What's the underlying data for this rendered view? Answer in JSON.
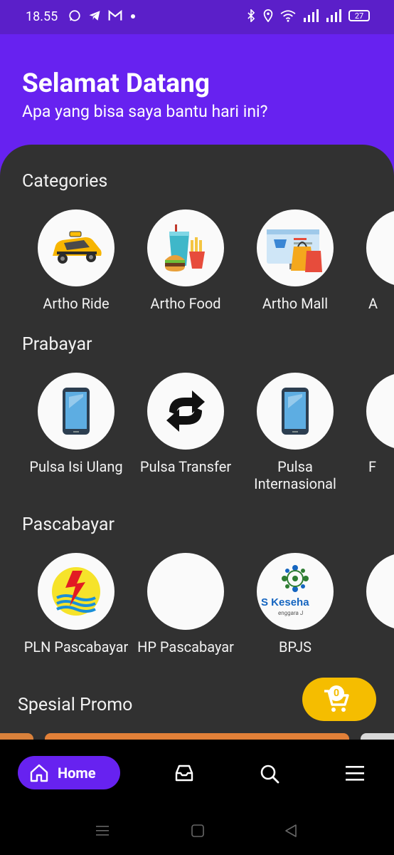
{
  "status_bar": {
    "time": "18.55",
    "battery": "27"
  },
  "header": {
    "title": "Selamat Datang",
    "subtitle": "Apa yang bisa saya bantu hari ini?"
  },
  "sections": {
    "categories": {
      "title": "Categories",
      "items": [
        "Artho Ride",
        "Artho Food",
        "Artho Mall"
      ],
      "partial_label": "A"
    },
    "prabayar": {
      "title": "Prabayar",
      "items": [
        "Pulsa Isi Ulang",
        "Pulsa Transfer",
        "Pulsa Internasional"
      ],
      "partial_label": "F"
    },
    "pascabayar": {
      "title": "Pascabayar",
      "items": [
        "PLN Pascabayar",
        "HP Pascabayar",
        "BPJS"
      ]
    }
  },
  "bpjs_logo_text": "S Keseha",
  "bpjs_logo_subtext": "enggara J",
  "promo": {
    "title": "Spesial Promo"
  },
  "cart": {
    "count": "0"
  },
  "bottom_nav": {
    "home_label": "Home"
  },
  "colors": {
    "purple": "#6722f0",
    "panel": "#313131",
    "cart": "#f5bd00"
  }
}
